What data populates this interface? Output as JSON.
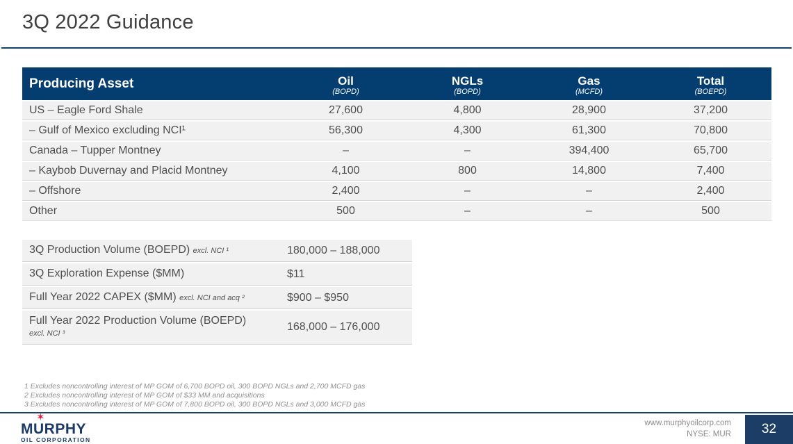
{
  "slide": {
    "title": "3Q 2022 Guidance"
  },
  "colors": {
    "header_navy": "#043e70",
    "rule_navy": "#17426b",
    "page_box_navy": "#1c3e66",
    "row_gray": "#f1f1f1",
    "body_text": "#4f4f4f",
    "title_text": "#3f3f3f",
    "footnote_gray": "#8f8f8f",
    "logo_navy": "#1b3a6b",
    "logo_red": "#e31837"
  },
  "production_table": {
    "columns": [
      {
        "label": "Producing Asset",
        "unit": ""
      },
      {
        "label": "Oil",
        "unit": "(BOPD)"
      },
      {
        "label": "NGLs",
        "unit": "(BOPD)"
      },
      {
        "label": "Gas",
        "unit": "(MCFD)"
      },
      {
        "label": "Total",
        "unit": "(BOEPD)"
      }
    ],
    "rows": [
      {
        "asset": "US – Eagle Ford Shale",
        "oil": "27,600",
        "ngls": "4,800",
        "gas": "28,900",
        "total": "37,200"
      },
      {
        "asset": "– Gulf of Mexico excluding NCI¹",
        "oil": "56,300",
        "ngls": "4,300",
        "gas": "61,300",
        "total": "70,800"
      },
      {
        "asset": "Canada – Tupper Montney",
        "oil": "–",
        "ngls": "–",
        "gas": "394,400",
        "total": "65,700"
      },
      {
        "asset": "– Kaybob Duvernay and Placid Montney",
        "oil": "4,100",
        "ngls": "800",
        "gas": "14,800",
        "total": "7,400"
      },
      {
        "asset": "– Offshore",
        "oil": "2,400",
        "ngls": "–",
        "gas": "–",
        "total": "2,400"
      },
      {
        "asset": "Other",
        "oil": "500",
        "ngls": "–",
        "gas": "–",
        "total": "500"
      }
    ]
  },
  "guidance_table": {
    "rows": [
      {
        "label": "3Q Production Volume (BOEPD)",
        "note": "excl. NCI ¹",
        "value": "180,000 – 188,000"
      },
      {
        "label": "3Q Exploration Expense ($MM)",
        "note": "",
        "value": "$11"
      },
      {
        "label": "Full Year 2022 CAPEX ($MM)",
        "note": "excl. NCI and acq ²",
        "value": "$900 – $950"
      },
      {
        "label": "Full Year 2022 Production Volume (BOEPD)",
        "note": "excl. NCI ³",
        "value": "168,000 – 176,000"
      }
    ]
  },
  "footnotes": [
    "1 Excludes noncontrolling interest of MP GOM of 6,700 BOPD oil, 300 BOPD NGLs and 2,700 MCFD gas",
    "2 Excludes noncontrolling interest of MP GOM of $33 MM and acquisitions",
    "3 Excludes noncontrolling interest of MP GOM of 7,800 BOPD oil, 300 BOPD NGLs and 3,000 MCFD gas"
  ],
  "footer": {
    "logo_word": "MURPHY",
    "logo_sub": "OIL CORPORATION",
    "logo_star": "✶",
    "website": "www.murphyoilcorp.com",
    "ticker": "NYSE: MUR",
    "page_number": "32"
  }
}
